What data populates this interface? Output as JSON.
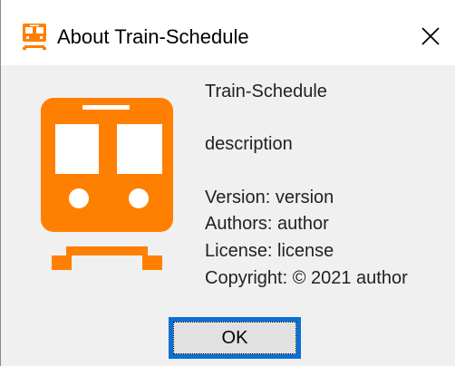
{
  "window": {
    "title": "About Train-Schedule",
    "icon": "train-icon",
    "close_icon": "close-icon"
  },
  "about": {
    "app_name": "Train-Schedule",
    "description": "description",
    "version": "Version: version",
    "authors": "Authors: author",
    "license": "License: license",
    "copyright": "Copyright: © 2021 author"
  },
  "buttons": {
    "ok_label": "OK"
  },
  "colors": {
    "accent": "#ff7f00",
    "focus_border": "#0a6fd6",
    "background": "#f0f0f0"
  }
}
